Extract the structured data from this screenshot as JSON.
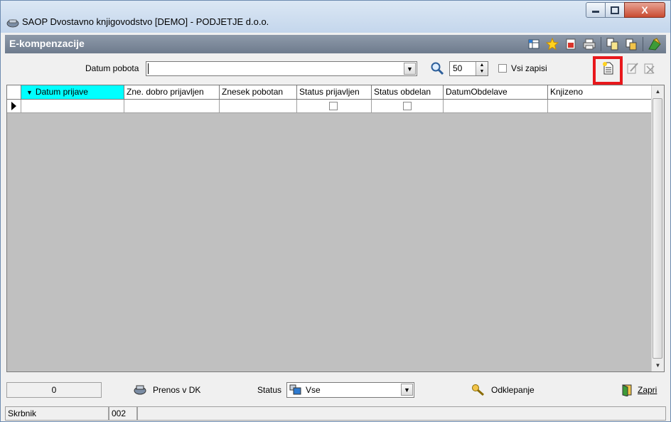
{
  "window": {
    "title": "SAOP Dvostavno knjigovodstvo [DEMO] - PODJETJE d.o.o.",
    "controls": {
      "minimize": "_",
      "maximize": "□",
      "close": "X"
    }
  },
  "header": {
    "title": "E-kompenzacije",
    "tools": [
      "columns-icon",
      "star-icon",
      "export-icon",
      "print-icon",
      "copy-icon",
      "paste-icon",
      "exit-icon"
    ]
  },
  "filter": {
    "date_label": "Datum pobota",
    "date_value": "",
    "limit_value": "50",
    "all_records_label": "Vsi zapisi",
    "all_records_checked": false
  },
  "grid": {
    "columns": [
      "Datum prijave",
      "Zne. dobro prijavljen",
      "Znesek pobotan",
      "Status prijavljen",
      "Status obdelan",
      "DatumObdelave",
      "Knjizeno"
    ],
    "sorted_column": "Datum prijave",
    "rows": [
      {
        "Datum prijave": "",
        "Zne. dobro prijavljen": "",
        "Znesek pobotan": "",
        "Status prijavljen": false,
        "Status obdelan": false,
        "DatumObdelave": "",
        "Knjizeno": ""
      }
    ]
  },
  "bottom": {
    "count": "0",
    "transfer_label": "Prenos v DK",
    "status_label": "Status",
    "status_value": "Vse",
    "unlock_label": "Odklepanje",
    "close_label": "Zapri"
  },
  "statusbar": {
    "user": "Skrbnik",
    "code": "002",
    "info": ""
  },
  "colors": {
    "header_band": "#7a8698",
    "selected_column": "#00ffff",
    "highlight": "#e8181c"
  }
}
